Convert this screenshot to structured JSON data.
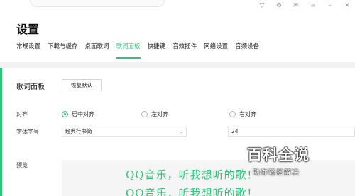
{
  "header": {
    "title": "设置",
    "icons": [
      "shirt-icon",
      "settings-icon",
      "mail-icon",
      "menu-icon",
      "minimize-icon",
      "close-icon"
    ]
  },
  "tabs": [
    {
      "label": "常规设置",
      "active": false
    },
    {
      "label": "下载与缓存",
      "active": false
    },
    {
      "label": "桌面歌词",
      "active": false
    },
    {
      "label": "歌词面板",
      "active": true
    },
    {
      "label": "快捷键",
      "active": false
    },
    {
      "label": "音效插件",
      "active": false
    },
    {
      "label": "网络设置",
      "active": false
    },
    {
      "label": "音频设备",
      "active": false
    }
  ],
  "section": {
    "title": "歌词面板",
    "restore_label": "恢复默认"
  },
  "align": {
    "label": "对齐",
    "options": [
      {
        "label": "居中对齐",
        "checked": true
      },
      {
        "label": "左对齐",
        "checked": false
      },
      {
        "label": "右对齐",
        "checked": false
      }
    ]
  },
  "font": {
    "label": "字体字号",
    "family_value": "经典行书简",
    "size_value": "24"
  },
  "preview": {
    "label": "预览",
    "lines": [
      "QQ音乐，听我想听的歌！",
      "QQ音乐，听我想听的歌！"
    ]
  },
  "watermark": {
    "main": "百科全说",
    "sub": "助你轻松解决"
  },
  "colors": {
    "accent": "#31c27c"
  }
}
